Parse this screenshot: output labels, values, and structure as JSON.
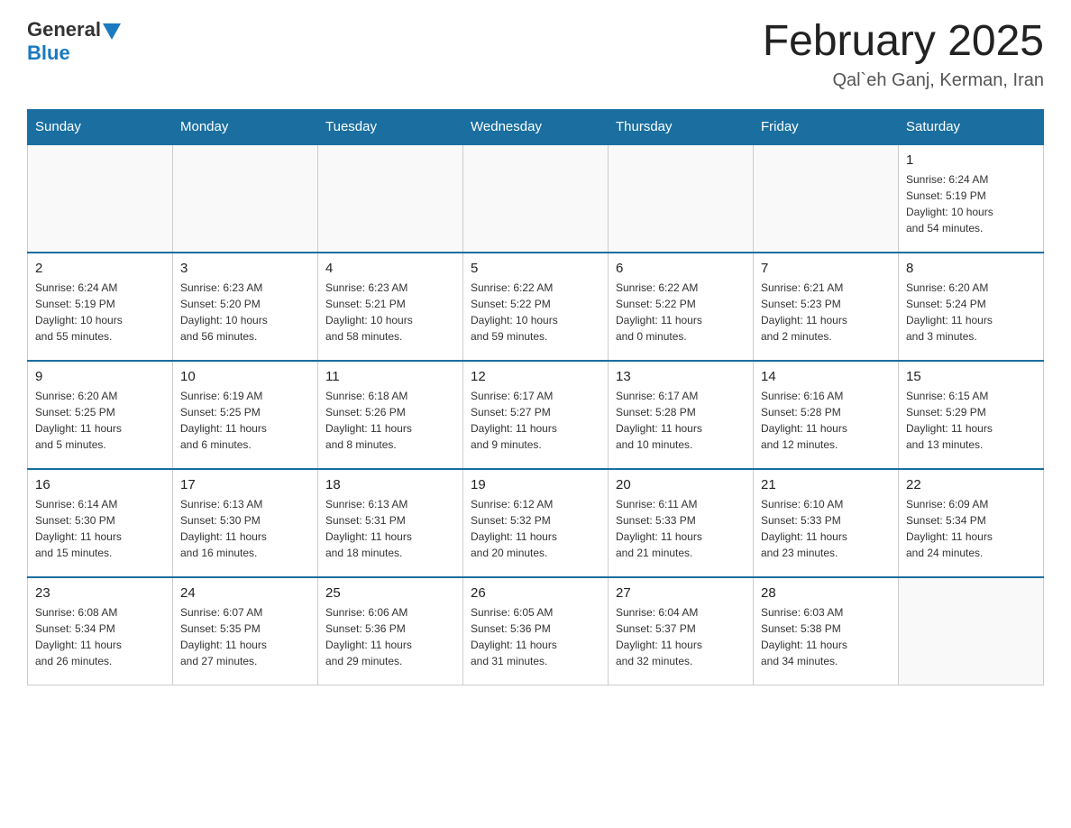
{
  "header": {
    "logo_general": "General",
    "logo_blue": "Blue",
    "month_title": "February 2025",
    "location": "Qal`eh Ganj, Kerman, Iran"
  },
  "days_of_week": [
    "Sunday",
    "Monday",
    "Tuesday",
    "Wednesday",
    "Thursday",
    "Friday",
    "Saturday"
  ],
  "weeks": [
    [
      {
        "day": "",
        "info": ""
      },
      {
        "day": "",
        "info": ""
      },
      {
        "day": "",
        "info": ""
      },
      {
        "day": "",
        "info": ""
      },
      {
        "day": "",
        "info": ""
      },
      {
        "day": "",
        "info": ""
      },
      {
        "day": "1",
        "info": "Sunrise: 6:24 AM\nSunset: 5:19 PM\nDaylight: 10 hours\nand 54 minutes."
      }
    ],
    [
      {
        "day": "2",
        "info": "Sunrise: 6:24 AM\nSunset: 5:19 PM\nDaylight: 10 hours\nand 55 minutes."
      },
      {
        "day": "3",
        "info": "Sunrise: 6:23 AM\nSunset: 5:20 PM\nDaylight: 10 hours\nand 56 minutes."
      },
      {
        "day": "4",
        "info": "Sunrise: 6:23 AM\nSunset: 5:21 PM\nDaylight: 10 hours\nand 58 minutes."
      },
      {
        "day": "5",
        "info": "Sunrise: 6:22 AM\nSunset: 5:22 PM\nDaylight: 10 hours\nand 59 minutes."
      },
      {
        "day": "6",
        "info": "Sunrise: 6:22 AM\nSunset: 5:22 PM\nDaylight: 11 hours\nand 0 minutes."
      },
      {
        "day": "7",
        "info": "Sunrise: 6:21 AM\nSunset: 5:23 PM\nDaylight: 11 hours\nand 2 minutes."
      },
      {
        "day": "8",
        "info": "Sunrise: 6:20 AM\nSunset: 5:24 PM\nDaylight: 11 hours\nand 3 minutes."
      }
    ],
    [
      {
        "day": "9",
        "info": "Sunrise: 6:20 AM\nSunset: 5:25 PM\nDaylight: 11 hours\nand 5 minutes."
      },
      {
        "day": "10",
        "info": "Sunrise: 6:19 AM\nSunset: 5:25 PM\nDaylight: 11 hours\nand 6 minutes."
      },
      {
        "day": "11",
        "info": "Sunrise: 6:18 AM\nSunset: 5:26 PM\nDaylight: 11 hours\nand 8 minutes."
      },
      {
        "day": "12",
        "info": "Sunrise: 6:17 AM\nSunset: 5:27 PM\nDaylight: 11 hours\nand 9 minutes."
      },
      {
        "day": "13",
        "info": "Sunrise: 6:17 AM\nSunset: 5:28 PM\nDaylight: 11 hours\nand 10 minutes."
      },
      {
        "day": "14",
        "info": "Sunrise: 6:16 AM\nSunset: 5:28 PM\nDaylight: 11 hours\nand 12 minutes."
      },
      {
        "day": "15",
        "info": "Sunrise: 6:15 AM\nSunset: 5:29 PM\nDaylight: 11 hours\nand 13 minutes."
      }
    ],
    [
      {
        "day": "16",
        "info": "Sunrise: 6:14 AM\nSunset: 5:30 PM\nDaylight: 11 hours\nand 15 minutes."
      },
      {
        "day": "17",
        "info": "Sunrise: 6:13 AM\nSunset: 5:30 PM\nDaylight: 11 hours\nand 16 minutes."
      },
      {
        "day": "18",
        "info": "Sunrise: 6:13 AM\nSunset: 5:31 PM\nDaylight: 11 hours\nand 18 minutes."
      },
      {
        "day": "19",
        "info": "Sunrise: 6:12 AM\nSunset: 5:32 PM\nDaylight: 11 hours\nand 20 minutes."
      },
      {
        "day": "20",
        "info": "Sunrise: 6:11 AM\nSunset: 5:33 PM\nDaylight: 11 hours\nand 21 minutes."
      },
      {
        "day": "21",
        "info": "Sunrise: 6:10 AM\nSunset: 5:33 PM\nDaylight: 11 hours\nand 23 minutes."
      },
      {
        "day": "22",
        "info": "Sunrise: 6:09 AM\nSunset: 5:34 PM\nDaylight: 11 hours\nand 24 minutes."
      }
    ],
    [
      {
        "day": "23",
        "info": "Sunrise: 6:08 AM\nSunset: 5:34 PM\nDaylight: 11 hours\nand 26 minutes."
      },
      {
        "day": "24",
        "info": "Sunrise: 6:07 AM\nSunset: 5:35 PM\nDaylight: 11 hours\nand 27 minutes."
      },
      {
        "day": "25",
        "info": "Sunrise: 6:06 AM\nSunset: 5:36 PM\nDaylight: 11 hours\nand 29 minutes."
      },
      {
        "day": "26",
        "info": "Sunrise: 6:05 AM\nSunset: 5:36 PM\nDaylight: 11 hours\nand 31 minutes."
      },
      {
        "day": "27",
        "info": "Sunrise: 6:04 AM\nSunset: 5:37 PM\nDaylight: 11 hours\nand 32 minutes."
      },
      {
        "day": "28",
        "info": "Sunrise: 6:03 AM\nSunset: 5:38 PM\nDaylight: 11 hours\nand 34 minutes."
      },
      {
        "day": "",
        "info": ""
      }
    ]
  ]
}
